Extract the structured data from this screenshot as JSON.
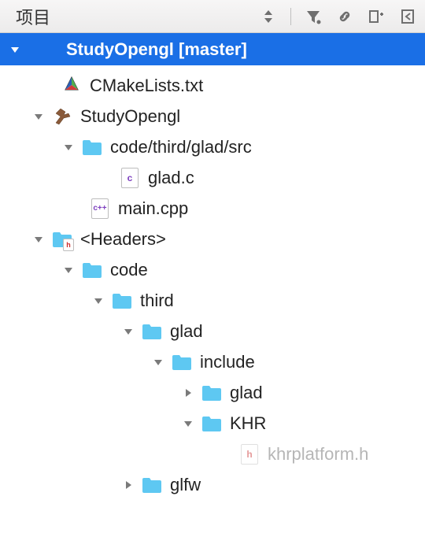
{
  "header": {
    "title": "项目"
  },
  "selected": {
    "name": "StudyOpengl",
    "branch": "[master]"
  },
  "tree": {
    "cmake": "CMakeLists.txt",
    "target": "StudyOpengl",
    "srcFolder": "code/third/glad/src",
    "srcFile": "glad.c",
    "mainFile": "main.cpp",
    "headersGroup": "<Headers>",
    "folders": {
      "code": "code",
      "third": "third",
      "glad": "glad",
      "include": "include",
      "gladSub": "glad",
      "khr": "KHR",
      "glfw": "glfw"
    },
    "khrFile": "khrplatform.h"
  }
}
